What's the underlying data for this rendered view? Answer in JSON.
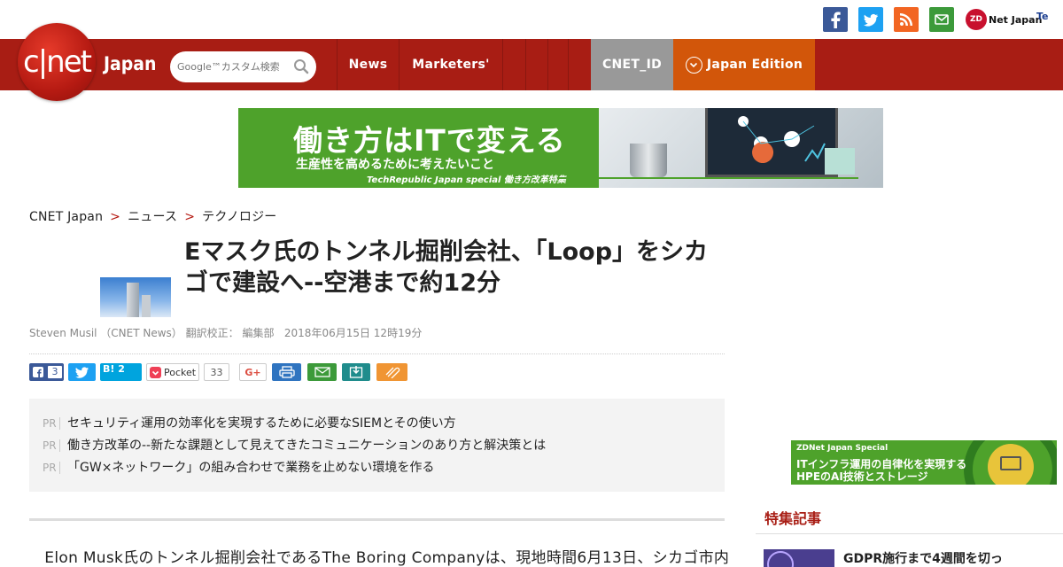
{
  "header": {
    "logo_text": "c|net",
    "edition_label": "Japan",
    "search": {
      "placeholder": "Google™カスタム検索"
    },
    "nav": [
      {
        "label": "News"
      },
      {
        "label": "Marketers'"
      },
      {
        "label": ""
      },
      {
        "label": ""
      },
      {
        "label": ""
      },
      {
        "label": "CNET_ID"
      },
      {
        "label": "Japan Edition"
      }
    ],
    "zdnet_label": "Net Japan",
    "zdnet_mark": "ZD",
    "tech_label": "Te"
  },
  "colors": {
    "brand_red": "#a81d14",
    "cnet_id_bg": "#999999",
    "edition_bg": "#d2560a",
    "ad_green": "#4ea22b"
  },
  "social_icons": [
    "facebook-icon",
    "twitter-icon",
    "rss-icon",
    "mail-icon"
  ],
  "banner_ad": {
    "headline": "働き方はITで変える",
    "subline": "生産性を高めるために考えたいこと",
    "footer": "TechRepublic Japan special 働き方改革特集"
  },
  "breadcrumb": [
    {
      "label": "CNET Japan"
    },
    {
      "label": "ニュース"
    },
    {
      "label": "テクノロジー"
    }
  ],
  "breadcrumb_sep": ">",
  "article": {
    "title": "Eマスク氏のトンネル掘削会社、「Loop」をシカゴで建設へ--空港まで約12分",
    "byline_author": "Steven Musil （CNET News） 翻訳校正： 編集部",
    "byline_date": "2018年06月15日 12時19分",
    "share": {
      "facebook_count": "3",
      "hatena_label": "B!",
      "hatena_count": "2",
      "pocket_label": "Pocket",
      "pocket_count": "33",
      "gplus_label": "G+"
    },
    "pr_label": "PR",
    "pr_items": [
      "セキュリティ運用の効率化を実現するために必要なSIEMとその使い方",
      "働き方改革の--新たな課題として見えてきたコミュニケーションのあり方と解決策とは",
      "「GW×ネットワーク」の組み合わせで業務を止めない環境を作る"
    ],
    "body_first_line": "　Elon Musk氏のトンネル掘削会社であるThe Boring Companyは、現地時間6月13日、シカゴ市内と空港を結ぶ"
  },
  "sidebar": {
    "ad_label": "ZDNet Japan Special",
    "ad_line1": "ITインフラ運用の自律化を実現する",
    "ad_line2": "HPEのAI技術とストレージ",
    "section_title": "特集記事",
    "item_title": "GDPR施行まで4週間を切っ"
  }
}
